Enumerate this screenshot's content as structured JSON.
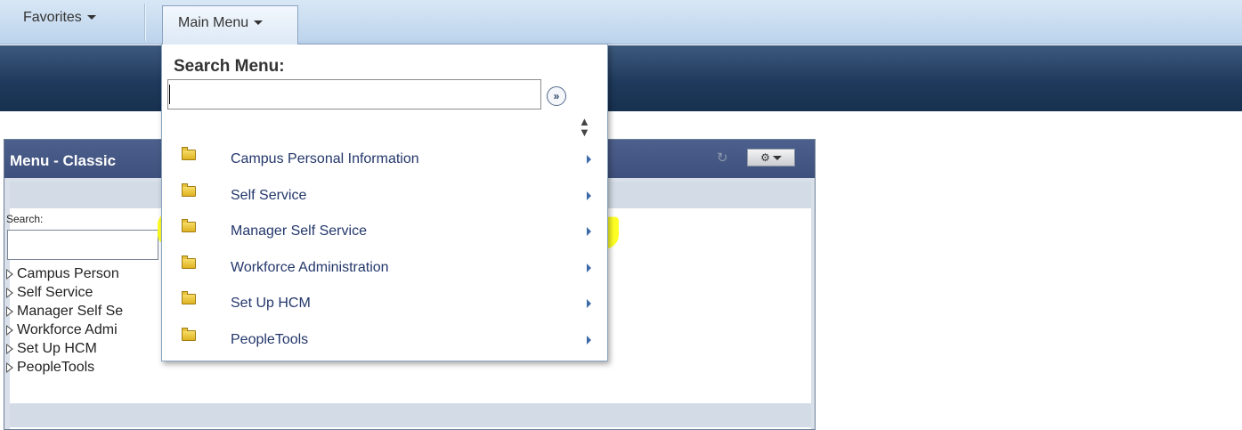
{
  "topnav": {
    "favorites_label": "Favorites",
    "main_menu_label": "Main Menu"
  },
  "pagelet": {
    "title": "Menu - Classic",
    "search_label": "Search:",
    "tree_items": [
      "Campus Person",
      "Self Service",
      "Manager Self Se",
      "Workforce Admi",
      "Set Up HCM",
      "PeopleTools"
    ]
  },
  "dropdown": {
    "title": "Search Menu:",
    "search_value": "",
    "items": [
      {
        "label": "Campus Personal Information",
        "icon": "folder-icon"
      },
      {
        "label": "Self Service",
        "icon": "folder-icon"
      },
      {
        "label": "Manager Self Service",
        "icon": "folder-icon",
        "highlighted": true
      },
      {
        "label": "Workforce Administration",
        "icon": "folder-icon"
      },
      {
        "label": "Set Up HCM",
        "icon": "folder-icon"
      },
      {
        "label": "PeopleTools",
        "icon": "folder-icon"
      }
    ]
  },
  "colors": {
    "nav_bar": "#c8dcf0",
    "banner": "#1f3a5c",
    "pagelet_header": "#45578a",
    "menu_link": "#23376b",
    "highlight": "#ffff00"
  }
}
